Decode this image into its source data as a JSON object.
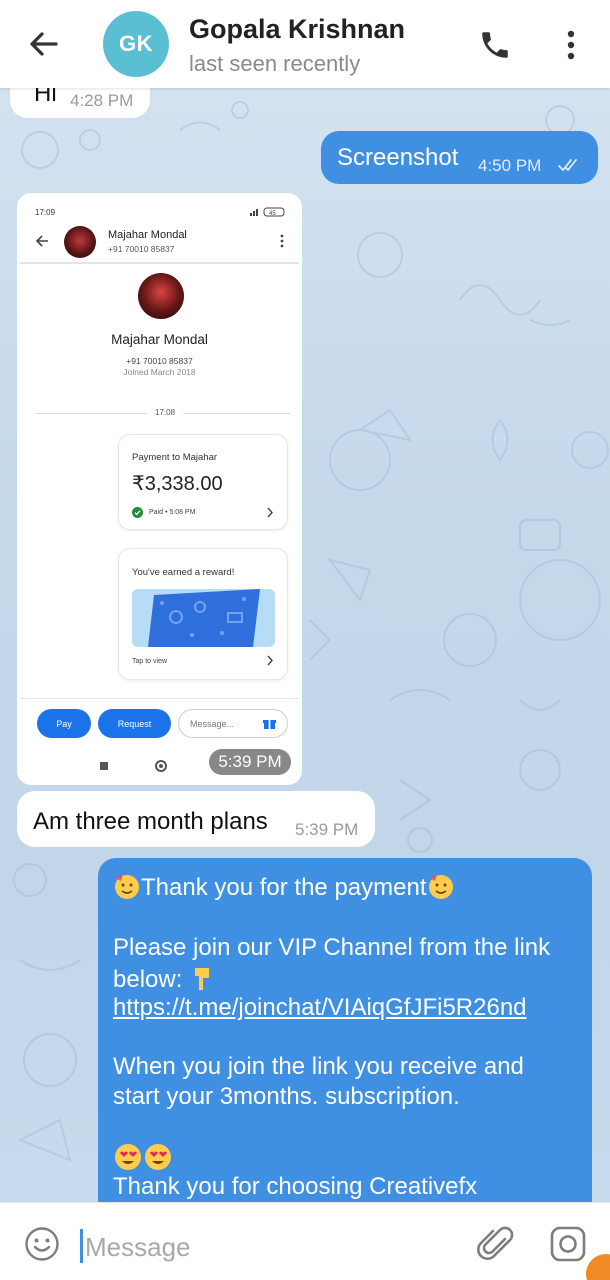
{
  "header": {
    "avatar_initials": "GK",
    "avatar_color": "#5bbfd4",
    "contact_name": "Gopala Krishnan",
    "status": "last seen recently",
    "icons": [
      "back-arrow-icon",
      "phone-icon",
      "more-vert-icon"
    ]
  },
  "messages": {
    "m1": {
      "text": "Hi",
      "time": "4:28 PM"
    },
    "m2": {
      "text": "Screenshot",
      "time": "4:50 PM",
      "status_icon": "double-check-icon"
    },
    "m3": {
      "time": "5:39 PM",
      "screenshot": {
        "status_time": "17:09",
        "status_battery": "45",
        "contact_name": "Majahar Mondal",
        "contact_phone": "+91 70010 85837",
        "joined": "Joined March 2018",
        "timeline_time": "17:08",
        "payment_title": "Payment to Majahar",
        "payment_amount": "₹3,338.00",
        "payment_status": "Paid • 5:08 PM",
        "reward_title": "You've earned a reward!",
        "reward_action": "Tap to view",
        "pay_label": "Pay",
        "request_label": "Request",
        "message_placeholder": "Message..."
      }
    },
    "m4": {
      "text": "Am three month plans",
      "time": "5:39 PM"
    },
    "m5": {
      "line1": "Thank you for the payment",
      "line2": "Please join our VIP Channel from the link",
      "line3": "below: ",
      "link": "https://t.me/joinchat/VIAiqGfJFi5R26nd",
      "line5": "When you join the link you receive and",
      "line6": "start your 3months. subscription.",
      "line8": "Thank you for choosing Creativefx"
    }
  },
  "input": {
    "placeholder": "Message"
  },
  "colors": {
    "outgoing_bubble": "#3f8fe3",
    "incoming_bubble": "#ffffff",
    "chat_background": "#c7d9ec",
    "accent": "#f08a24"
  }
}
